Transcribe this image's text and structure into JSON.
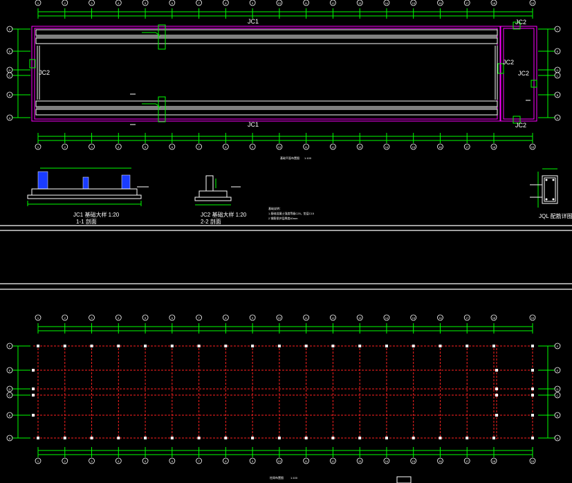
{
  "plan1": {
    "caption": "基础平面布置图",
    "scale": "1:100",
    "labels": {
      "jc1_top": "JC1",
      "jc1_bottom": "JC1",
      "jc2_left": "JC2",
      "jc2_tr": "JC2",
      "jc2_mid": "JC2",
      "jc2_right": "JC2",
      "jc2_br": "JC2"
    },
    "grid_cols": [
      "1",
      "2",
      "3",
      "4",
      "5",
      "6",
      "7",
      "8",
      "9",
      "10",
      "11",
      "12",
      "13",
      "14",
      "15",
      "16",
      "17",
      "18",
      "19"
    ],
    "grid_rows": [
      "F",
      "E",
      "D",
      "C",
      "B",
      "A"
    ]
  },
  "details": {
    "jc1_title": "JC1 基础大样  1:20",
    "jc1_section": "1-1 剖面",
    "jc2_title": "JC2 基础大样  1:20",
    "jc2_section": "2-2 剖面",
    "jql_title": "JQL 配筋详图",
    "notes_title": "基础说明：",
    "notes_line1": "1.基础混凝土强度等级C25，垫层C15",
    "notes_line2": "2.钢筋保护层厚度40mm"
  },
  "plan2": {
    "caption": "柱网布置图",
    "scale": "1:100"
  },
  "colors": {
    "grid": "#00ff00",
    "outline": "#ff00ff",
    "beam": "#ff2020",
    "text": "#ffffff",
    "column": "#1a3cff"
  }
}
